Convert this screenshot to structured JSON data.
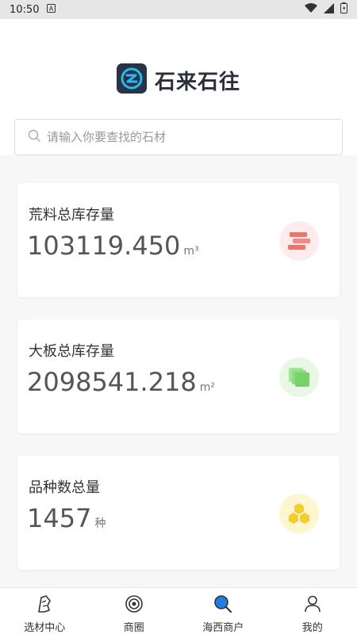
{
  "status_bar": {
    "time": "10:50"
  },
  "header": {
    "app_name": "石来石往"
  },
  "search": {
    "placeholder": "请输入你要查找的石材"
  },
  "cards": [
    {
      "title": "荒料总库存量",
      "value": "103119.450",
      "unit": "m³",
      "icon": "stacked-blocks-icon",
      "icon_bg": "#fdeceb",
      "icon_color": "#f0746c"
    },
    {
      "title": "大板总库存量",
      "value": "2098541.218",
      "unit": "m²",
      "icon": "stacked-slabs-icon",
      "icon_bg": "#e8f8e4",
      "icon_color": "#77d26a"
    },
    {
      "title": "品种数总量",
      "value": "1457",
      "unit": "种",
      "icon": "hexagon-cluster-icon",
      "icon_bg": "#fdf6cf",
      "icon_color": "#f2cd2e"
    }
  ],
  "tabbar": [
    {
      "label": "选材中心",
      "icon": "stone-select-icon"
    },
    {
      "label": "商圈",
      "icon": "circle-target-icon"
    },
    {
      "label": "海西商户",
      "icon": "magnifier-icon",
      "active": true
    },
    {
      "label": "我的",
      "icon": "person-icon"
    }
  ],
  "colors": {
    "accent": "#1e7fe0",
    "logo_bg": "#263445",
    "logo_ring": "#2bb8ef"
  }
}
